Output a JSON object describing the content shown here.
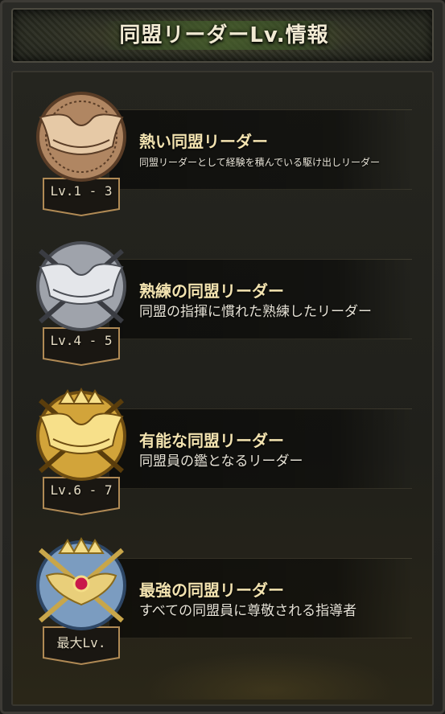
{
  "header": {
    "title": "同盟リーダーLv.情報"
  },
  "ranks": [
    {
      "title": "熱い同盟リーダー",
      "description": "同盟リーダーとして経験を積んでいる駆け出しリーダー",
      "level": "Lv.1 - 3",
      "icon": "bronze-leader-badge-icon",
      "colors": {
        "light": "#e6c9a6",
        "mid": "#b08662",
        "dark": "#5a3d27"
      }
    },
    {
      "title": "熟練の同盟リーダー",
      "description": "同盟の指揮に慣れた熟練したリーダー",
      "level": "Lv.4 - 5",
      "icon": "silver-leader-badge-icon",
      "colors": {
        "light": "#e4e6ea",
        "mid": "#9fa3ab",
        "dark": "#4b4e55"
      }
    },
    {
      "title": "有能な同盟リーダー",
      "description": "同盟員の鑑となるリーダー",
      "level": "Lv.6 - 7",
      "icon": "gold-leader-badge-icon",
      "colors": {
        "light": "#f7e08a",
        "mid": "#d2a43a",
        "dark": "#6e4d12"
      }
    },
    {
      "title": "最強の同盟リーダー",
      "description": "すべての同盟員に尊敬される指導者",
      "level": "最大Lv.",
      "icon": "jeweled-crown-leader-badge-icon",
      "colors": {
        "light": "#cfe0f2",
        "mid": "#7b9cc0",
        "dark": "#2e4766"
      }
    }
  ]
}
